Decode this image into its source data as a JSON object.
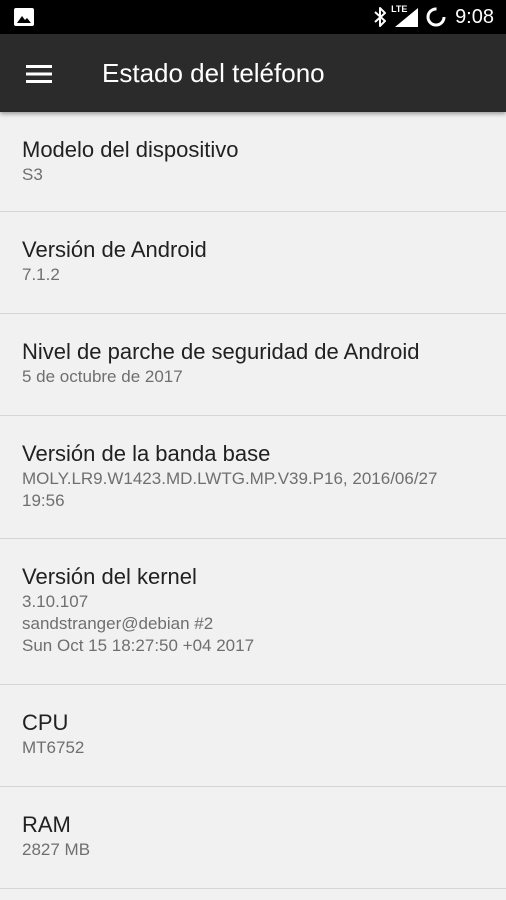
{
  "status_bar": {
    "time": "9:08",
    "network": "LTE",
    "icons": [
      "image-icon",
      "bluetooth-icon",
      "lte-signal-icon",
      "sync-icon"
    ]
  },
  "app_bar": {
    "title": "Estado del teléfono",
    "menu_icon": "hamburger-menu-icon"
  },
  "items": [
    {
      "title": "Modelo del dispositivo",
      "summary": "S3"
    },
    {
      "title": "Versión de Android",
      "summary": "7.1.2"
    },
    {
      "title": "Nivel de parche de seguridad de Android",
      "summary": "5 de octubre de 2017"
    },
    {
      "title": "Versión de la banda base",
      "summary": "MOLY.LR9.W1423.MD.LWTG.MP.V39.P16, 2016/06/27\n19:56"
    },
    {
      "title": "Versión del kernel",
      "summary": "3.10.107\nsandstranger@debian #2\nSun Oct 15 18:27:50 +04 2017"
    },
    {
      "title": "CPU",
      "summary": "MT6752"
    },
    {
      "title": "RAM",
      "summary": "2827 MB"
    }
  ],
  "colors": {
    "status_bar": "#000000",
    "app_bar": "#2b2b2b",
    "background": "#f1f1f1",
    "title_text": "#212121",
    "summary_text": "#6f6f6f",
    "divider": "#d6d6d6"
  }
}
